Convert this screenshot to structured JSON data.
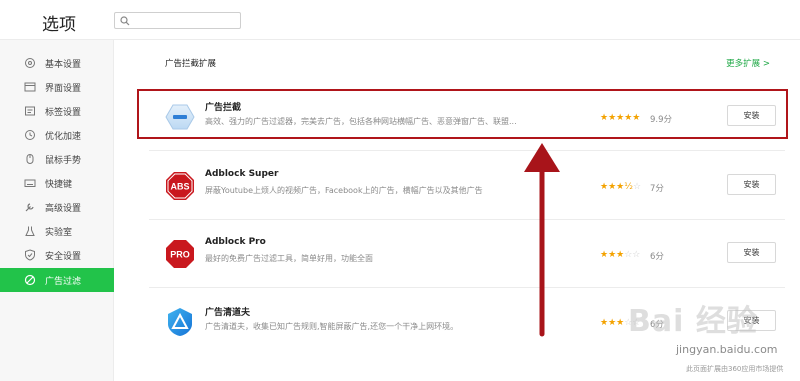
{
  "header": {
    "title": "选项",
    "search_value": ""
  },
  "sidebar": {
    "items": [
      {
        "label": "基本设置",
        "icon": "settings-circle-icon"
      },
      {
        "label": "界面设置",
        "icon": "window-icon"
      },
      {
        "label": "标签设置",
        "icon": "tab-icon"
      },
      {
        "label": "优化加速",
        "icon": "clock-icon"
      },
      {
        "label": "鼠标手势",
        "icon": "mouse-icon"
      },
      {
        "label": "快捷键",
        "icon": "keyboard-icon"
      },
      {
        "label": "高级设置",
        "icon": "wrench-icon"
      },
      {
        "label": "实验室",
        "icon": "flask-icon"
      },
      {
        "label": "安全设置",
        "icon": "shield-icon"
      },
      {
        "label": "广告过滤",
        "icon": "block-icon",
        "active": true
      }
    ]
  },
  "main": {
    "section_title": "广告拦截扩展",
    "more_link": "更多扩展 >",
    "extensions": [
      {
        "name": "广告拦截",
        "desc": "高效、强力的广告过滤器，完美去广告，包括各种网站横幅广告、恶意弹窗广告、联盟...",
        "rating": 5,
        "score": "9.9分",
        "install": "安装",
        "icon": "minus-circle-icon"
      },
      {
        "name": "Adblock Super",
        "desc": "屏蔽Youtube上烦人的视频广告，Facebook上的广告，横幅广告以及其他广告",
        "rating": 3.5,
        "score": "7分",
        "install": "安装",
        "icon": "abs-octagon-icon",
        "icon_text": "ABS"
      },
      {
        "name": "Adblock Pro",
        "desc": "最好的免费广告过滤工具，简单好用，功能全面",
        "rating": 3,
        "score": "6分",
        "install": "安装",
        "icon": "pro-octagon-icon",
        "icon_text": "PRO"
      },
      {
        "name": "广告清道夫",
        "desc": "广告清道夫，收集已知广告规则,智能屏蔽广告,还您一个干净上网环境。",
        "rating": 3,
        "score": "6分",
        "install": "安装",
        "icon": "triangle-shield-icon"
      }
    ]
  },
  "footer": {
    "note": "此页面扩展由360应用市场提供"
  },
  "watermark": {
    "logo": "Bai 经验",
    "url": "jingyan.baidu.com"
  },
  "colors": {
    "accent": "#22c34a",
    "star": "#f3a200",
    "annotation": "#b0151a"
  }
}
